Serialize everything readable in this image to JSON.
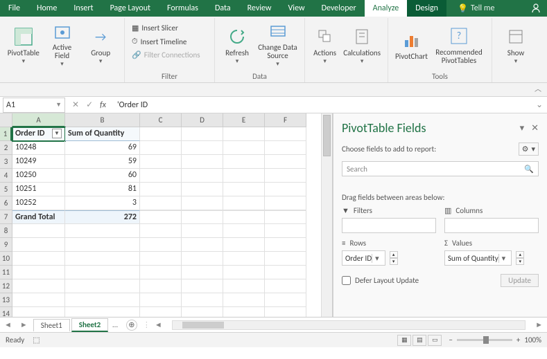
{
  "tabs": {
    "file": "File",
    "home": "Home",
    "insert": "Insert",
    "page_layout": "Page Layout",
    "formulas": "Formulas",
    "data": "Data",
    "review": "Review",
    "view": "View",
    "developer": "Developer",
    "analyze": "Analyze",
    "design": "Design",
    "tell_me": "Tell me"
  },
  "ribbon": {
    "pivottable": "PivotTable",
    "active_field": "Active Field",
    "group": "Group",
    "insert_slicer": "Insert Slicer",
    "insert_timeline": "Insert Timeline",
    "filter_connections": "Filter Connections",
    "filter_group": "Filter",
    "refresh": "Refresh",
    "change_data": "Change Data Source",
    "data_group": "Data",
    "actions": "Actions",
    "calculations": "Calculations",
    "pivotchart": "PivotChart",
    "recommended": "Recommended PivotTables",
    "tools_group": "Tools",
    "show": "Show"
  },
  "namebox": "A1",
  "formula": "'Order ID",
  "columns": [
    "A",
    "B",
    "C",
    "D",
    "E",
    "F"
  ],
  "row_numbers": [
    "1",
    "2",
    "3",
    "4",
    "5",
    "6",
    "7",
    "8",
    "9",
    "10",
    "11",
    "12",
    "13",
    "14"
  ],
  "pivot_header_a": "Order ID",
  "pivot_header_b": "Sum of Quantity",
  "pivot_rows": [
    {
      "a": "10248",
      "b": "69"
    },
    {
      "a": "10249",
      "b": "59"
    },
    {
      "a": "10250",
      "b": "60"
    },
    {
      "a": "10251",
      "b": "81"
    },
    {
      "a": "10252",
      "b": "3"
    }
  ],
  "grand_total_label": "Grand Total",
  "grand_total_value": "272",
  "panel": {
    "title": "PivotTable Fields",
    "choose": "Choose fields to add to report:",
    "search_placeholder": "Search",
    "drag": "Drag fields between areas below:",
    "filters": "Filters",
    "columns": "Columns",
    "rows": "Rows",
    "values": "Values",
    "row_field": "Order ID",
    "value_field": "Sum of Quantity",
    "defer": "Defer Layout Update",
    "update": "Update"
  },
  "sheets": {
    "s1": "Sheet1",
    "s2": "Sheet2"
  },
  "status": {
    "ready": "Ready",
    "zoom": "100%"
  }
}
